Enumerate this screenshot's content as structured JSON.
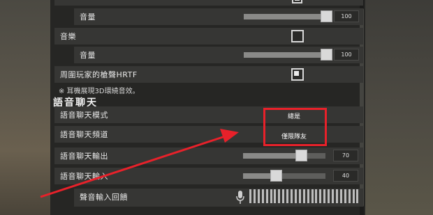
{
  "audio": {
    "top_volume_label": "音量",
    "top_volume_value": "100",
    "music_label": "音樂",
    "music_volume_label": "音量",
    "music_volume_value": "100",
    "hrtf_label": "周圍玩家的槍聲HRTF",
    "hrtf_note": "※ 耳機展現3D環繞音效。"
  },
  "voice_chat": {
    "section_title": "語音聊天",
    "mode_label": "語音聊天模式",
    "mode_value": "總是",
    "channel_label": "語音聊天頻道",
    "channel_value": "僅限隊友",
    "output_label": "語音聊天輸出",
    "output_value": "70",
    "input_label": "語音聊天輸入",
    "input_value": "40",
    "feedback_label": "聲音輸入回饋"
  },
  "levels": {
    "top_volume": 1.0,
    "music_volume": 1.0,
    "output": 0.7,
    "input": 0.4
  },
  "colors": {
    "annotation_red": "#e8212a"
  },
  "icons": {
    "mic": "microphone-icon"
  }
}
